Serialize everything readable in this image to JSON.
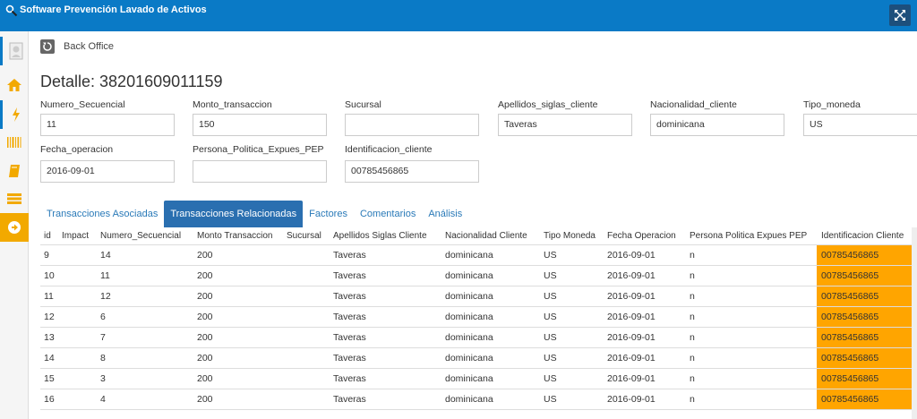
{
  "window": {
    "title": "Software Prevención Lavado de Activos"
  },
  "breadcrumb": {
    "label": "Back Office"
  },
  "page": {
    "title": "Detalle: 38201609011159"
  },
  "fields": [
    {
      "label": "Numero_Secuencial",
      "value": "11"
    },
    {
      "label": "Monto_transaccion",
      "value": "150"
    },
    {
      "label": "Sucursal",
      "value": ""
    },
    {
      "label": "Apellidos_siglas_cliente",
      "value": "Taveras"
    },
    {
      "label": "Nacionalidad_cliente",
      "value": "dominicana"
    },
    {
      "label": "Tipo_moneda",
      "value": "US"
    },
    {
      "label": "Fecha_operacion",
      "value": "2016-09-01"
    },
    {
      "label": "Persona_Politica_Expues_PEP",
      "value": ""
    },
    {
      "label": "Identificacion_cliente",
      "value": "00785456865"
    }
  ],
  "tabs": [
    {
      "label": "Transacciones Asociadas"
    },
    {
      "label": "Transacciones Relacionadas"
    },
    {
      "label": "Factores"
    },
    {
      "label": "Comentarios"
    },
    {
      "label": "Análisis"
    }
  ],
  "table": {
    "headers": [
      "id",
      "Impact",
      "Numero_Secuencial",
      "Monto Transaccion",
      "Sucursal",
      "Apellidos Siglas Cliente",
      "Nacionalidad Cliente",
      "Tipo Moneda",
      "Fecha Operacion",
      "Persona Politica Expues PEP",
      "Identificacion Cliente"
    ],
    "rows": [
      [
        "9",
        "",
        "14",
        "200",
        "",
        "Taveras",
        "dominicana",
        "US",
        "2016-09-01",
        "n",
        "00785456865"
      ],
      [
        "10",
        "",
        "11",
        "200",
        "",
        "Taveras",
        "dominicana",
        "US",
        "2016-09-01",
        "n",
        "00785456865"
      ],
      [
        "11",
        "",
        "12",
        "200",
        "",
        "Taveras",
        "dominicana",
        "US",
        "2016-09-01",
        "n",
        "00785456865"
      ],
      [
        "12",
        "",
        "6",
        "200",
        "",
        "Taveras",
        "dominicana",
        "US",
        "2016-09-01",
        "n",
        "00785456865"
      ],
      [
        "13",
        "",
        "7",
        "200",
        "",
        "Taveras",
        "dominicana",
        "US",
        "2016-09-01",
        "n",
        "00785456865"
      ],
      [
        "14",
        "",
        "8",
        "200",
        "",
        "Taveras",
        "dominicana",
        "US",
        "2016-09-01",
        "n",
        "00785456865"
      ],
      [
        "15",
        "",
        "3",
        "200",
        "",
        "Taveras",
        "dominicana",
        "US",
        "2016-09-01",
        "n",
        "00785456865"
      ],
      [
        "16",
        "",
        "4",
        "200",
        "",
        "Taveras",
        "dominicana",
        "US",
        "2016-09-01",
        "n",
        "00785456865"
      ]
    ]
  },
  "colors": {
    "titlebar": "#0a7ac6",
    "accent": "#2a6fb0",
    "highlight": "#ffa500",
    "sidebar_orange": "#f2a900"
  }
}
